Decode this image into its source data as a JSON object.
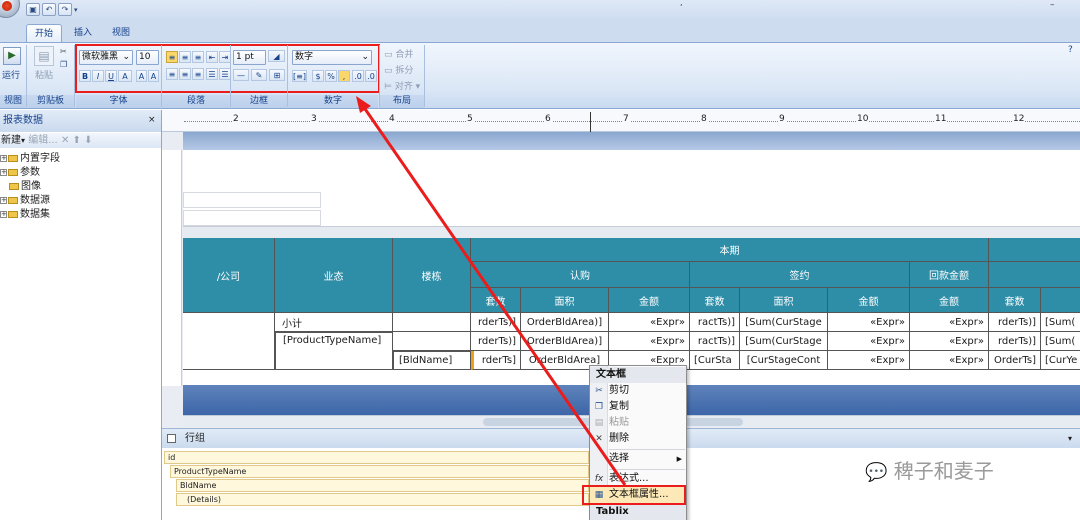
{
  "ribbon": {
    "tabs": [
      "开始",
      "插入",
      "视图"
    ],
    "run_label": "运行",
    "paste_label": "粘贴",
    "group_labels": [
      "视图",
      "剪贴板",
      "字体",
      "段落",
      "边框",
      "数字",
      "布局"
    ],
    "font_name": "微软雅黑",
    "font_size": "10",
    "border_width": "1 pt",
    "number_format": "数字",
    "merge_label": "合并",
    "split_label": "拆分",
    "align_label": "对齐"
  },
  "left_panel": {
    "title": "报表数据",
    "toolbar_new": "新建",
    "toolbar_edit": "编辑...",
    "tree": [
      "内置字段",
      "参数",
      "图像",
      "数据源",
      "数据集"
    ]
  },
  "ruler_numbers": [
    "2",
    "3",
    "4",
    "5",
    "6",
    "7",
    "8",
    "9",
    "10",
    "11",
    "12"
  ],
  "table": {
    "h_company": "/公司",
    "h_business": "业态",
    "h_building": "楼栋",
    "h_current": "本期",
    "h_subscribe": "认购",
    "h_sign": "签约",
    "h_return": "回款金额",
    "h_sets": "套数",
    "h_area": "面积",
    "h_amount": "金额",
    "row1": [
      "小计",
      "rderTs)]",
      "OrderBldArea)]",
      "«Expr»",
      "ractTs)]",
      "[Sum(CurStage",
      "«Expr»",
      "«Expr»",
      "rderTs)]",
      "[Sum("
    ],
    "row2": [
      "[ProductTypeName]",
      "rderTs)]",
      "OrderBldArea)]",
      "«Expr»",
      "ractTs)]",
      "[Sum(CurStage",
      "«Expr»",
      "«Expr»",
      "rderTs)]",
      "[Sum("
    ],
    "row3": [
      "[BldName]",
      "rderTs]",
      "OrderBldArea]",
      "«Expr»",
      "[CurSta",
      "[CurStageCont",
      "«Expr»",
      "«Expr»",
      "OrderTs]",
      "[CurYe"
    ]
  },
  "row_groups": {
    "title": "行组",
    "items": [
      "id",
      "ProductTypeName",
      "BldName",
      "(Details)"
    ]
  },
  "context_menu": {
    "header": "文本框",
    "items": [
      "剪切",
      "复制",
      "粘贴",
      "删除",
      "选择",
      "表达式...",
      "文本框属性..."
    ],
    "footer": "Tablix"
  },
  "watermark": "稗子和麦子",
  "colors": {
    "header_teal": "#2e8ea8",
    "highlight_red": "#ea1c1c",
    "ribbon_blue": "#dbe7f6"
  }
}
